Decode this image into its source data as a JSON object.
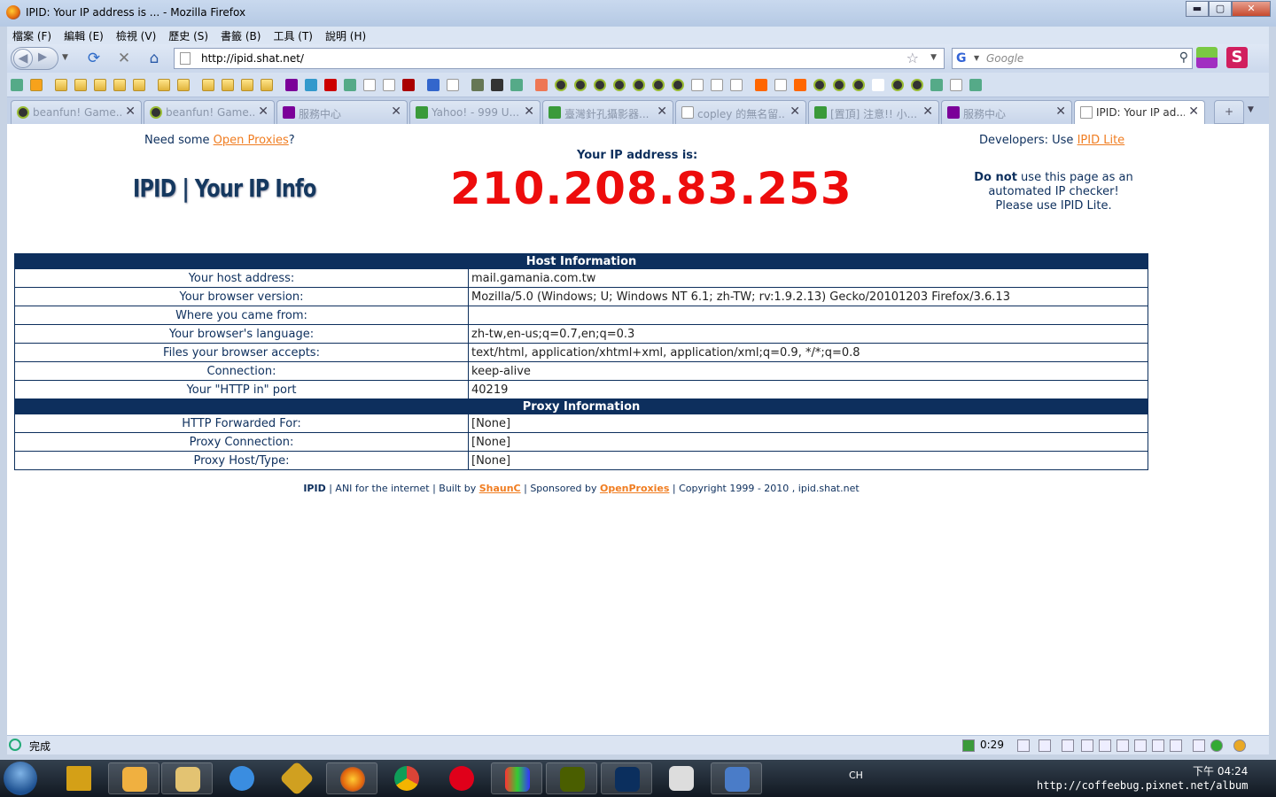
{
  "window": {
    "title": "IPID: Your IP address is ... - Mozilla Firefox",
    "min": "▬",
    "max": "▢",
    "close": "✕"
  },
  "menu": [
    "檔案 (F)",
    "編輯 (E)",
    "檢視 (V)",
    "歷史 (S)",
    "書籤 (B)",
    "工具 (T)",
    "說明 (H)"
  ],
  "nav": {
    "url": "http://ipid.shat.net/",
    "search_placeholder": "Google"
  },
  "tabs": [
    {
      "label": "beanfun! Game...",
      "color": "#333"
    },
    {
      "label": "beanfun! Game...",
      "color": "#333"
    },
    {
      "label": "服務中心",
      "color": "#7b0099"
    },
    {
      "label": "Yahoo! - 999 U...",
      "color": "#3a9a3a"
    },
    {
      "label": "臺灣針孔攝影器...",
      "color": "#3a9a3a"
    },
    {
      "label": "copley 的無名留...",
      "color": "#fff"
    },
    {
      "label": "[置頂] 注意!! 小...",
      "color": "#3a9a3a"
    },
    {
      "label": "服務中心",
      "color": "#7b0099"
    },
    {
      "label": "IPID: Your IP ad...",
      "color": "#fff"
    }
  ],
  "page": {
    "need_prefix": "Need some ",
    "need_link": "Open Proxies",
    "need_suffix": "?",
    "dev_prefix": "Developers: Use ",
    "dev_link": "IPID Lite",
    "logo": "IPID | Your IP Info",
    "ip_caption": "Your IP address is:",
    "ip": "210.208.83.253",
    "warn_bold": "Do not",
    "warn_rest": " use this page as an automated IP checker!",
    "please_prefix": "Please use ",
    "please_link": "IPID Lite",
    "please_suffix": ".",
    "host_header": "Host Information",
    "host_rows": [
      {
        "k": "Your host address:",
        "v": " mail.gamania.com.tw"
      },
      {
        "k": "Your browser version:",
        "v": "Mozilla/5.0 (Windows; U; Windows NT 6.1; zh-TW; rv:1.9.2.13) Gecko/20101203 Firefox/3.6.13"
      },
      {
        "k": "Where you came from:",
        "v": ""
      },
      {
        "k": "Your browser's language:",
        "v": "zh-tw,en-us;q=0.7,en;q=0.3"
      },
      {
        "k": "Files your browser accepts:",
        "v": "text/html, application/xhtml+xml, application/xml;q=0.9, */*;q=0.8"
      },
      {
        "k": "Connection:",
        "v": "keep-alive"
      },
      {
        "k": "Your \"HTTP in\" port",
        "v": "40219"
      }
    ],
    "proxy_header": "Proxy Information",
    "proxy_rows": [
      {
        "k": "HTTP Forwarded For:",
        "v": "[None]"
      },
      {
        "k": "Proxy Connection:",
        "v": "[None]"
      },
      {
        "k": "Proxy Host/Type:",
        "v": "[None]"
      }
    ],
    "footer": {
      "brand": "IPID",
      "t1": " | ANI for the internet | Built by ",
      "author": "ShaunC",
      "t2": " | Sponsored by ",
      "sponsor": "OpenProxies",
      "t3": " | Copyright 1999 - 2010 , ipid.shat.net"
    }
  },
  "status": {
    "text": "完成",
    "time": "0:29"
  },
  "taskbar": {
    "ime": "CH",
    "clock": "下午 04:24",
    "watermark": "http://coffeebug.pixnet.net/album"
  }
}
